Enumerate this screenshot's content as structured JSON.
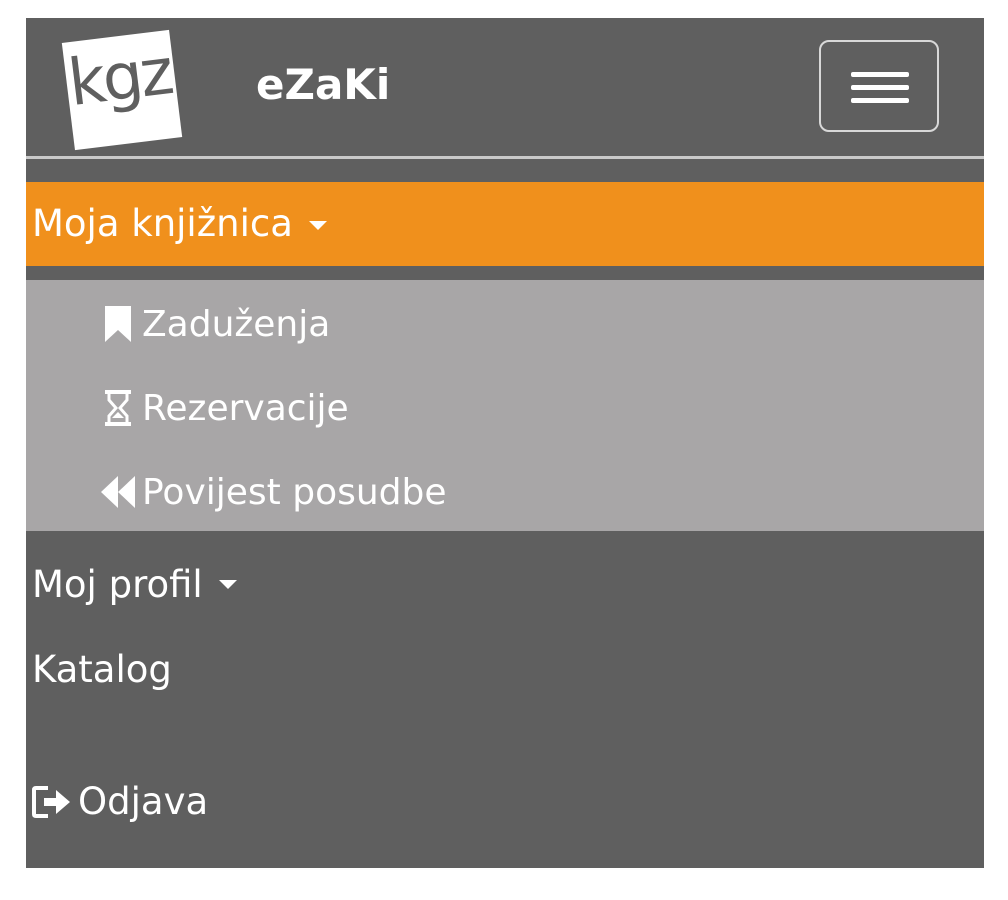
{
  "header": {
    "logo_text": "kgz",
    "app_title": "eZaKi",
    "menu_toggle_icon": "hamburger-icon"
  },
  "nav": {
    "moja_knjiznica": {
      "label": "Moja knjižnica",
      "icon": "caret-down-icon",
      "accent": "#f0901c",
      "items": [
        {
          "label": "Zaduženja",
          "icon": "bookmark-icon"
        },
        {
          "label": "Rezervacije",
          "icon": "hourglass-icon"
        },
        {
          "label": "Povijest posudbe",
          "icon": "backward-icon"
        }
      ]
    },
    "moj_profil": {
      "label": "Moj profil",
      "icon": "caret-down-icon"
    },
    "katalog": {
      "label": "Katalog"
    },
    "odjava": {
      "label": "Odjava",
      "icon": "logout-icon"
    }
  },
  "colors": {
    "header_bg": "#5f5f5f",
    "submenu_bg": "#a8a6a7",
    "text": "#ffffff"
  }
}
